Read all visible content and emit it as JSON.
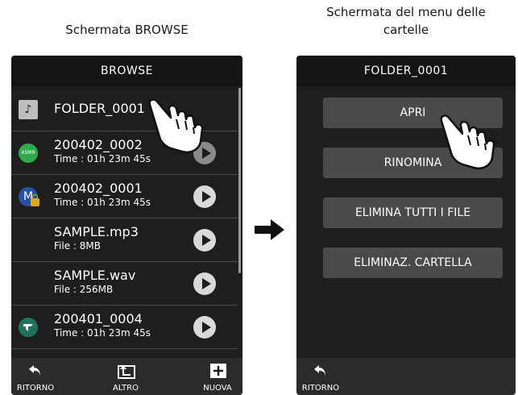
{
  "captions": {
    "left": "Schermata BROWSE",
    "right_line1": "Schermata del menu delle",
    "right_line2": "cartelle"
  },
  "browse_screen": {
    "title": "BROWSE",
    "items": [
      {
        "name": "FOLDER_0001",
        "sub": "",
        "icon": "folder-music-icon"
      },
      {
        "name": "200402_0002",
        "sub": "Time : 01h 23m 45s",
        "icon": "asmr-badge-icon",
        "badge_text": "ASMR"
      },
      {
        "name": "200402_0001",
        "sub": "Time : 01h 23m 45s",
        "icon": "mic-lock-badge-icon",
        "badge_text": "M"
      },
      {
        "name": "SAMPLE.mp3",
        "sub": "File : 8MB",
        "icon": ""
      },
      {
        "name": "SAMPLE.wav",
        "sub": "File : 256MB",
        "icon": ""
      },
      {
        "name": "200401_0004",
        "sub": "Time : 01h 23m 45s",
        "icon": "tascam-badge-icon"
      }
    ],
    "bottom": {
      "back": "RITORNO",
      "other": "ALTRO",
      "new": "NUOVA"
    }
  },
  "folder_menu_screen": {
    "title": "FOLDER_0001",
    "buttons": {
      "open": "APRI",
      "rename": "RINOMINA",
      "delete_all": "ELIMINA TUTTI I FILE",
      "delete_folder": "ELIMINAZ. CARTELLA"
    },
    "bottom": {
      "back": "RITORNO"
    }
  },
  "colors": {
    "screen_bg": "#1e1e1e",
    "menu_button": "#4a4a4a",
    "asmr_badge": "#2faa4d",
    "m_badge": "#2450a6",
    "tascam_badge": "#20735a"
  }
}
